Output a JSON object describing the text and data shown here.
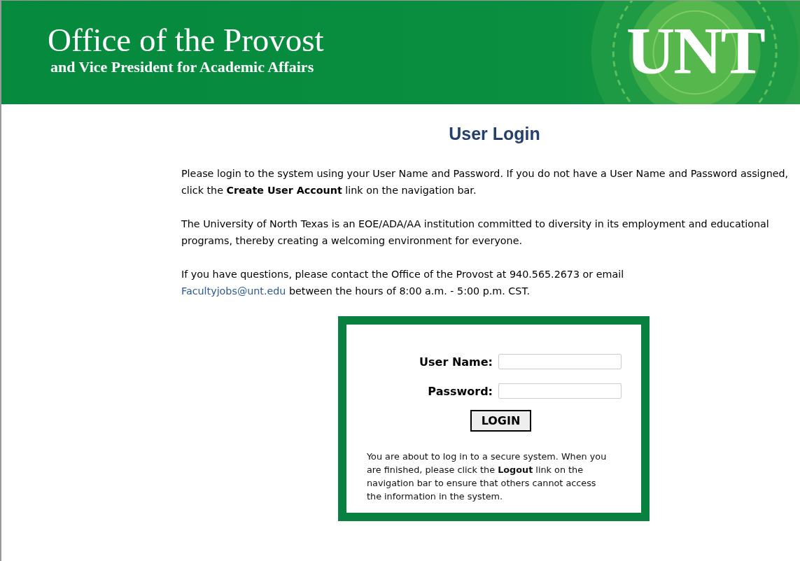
{
  "header": {
    "title": "Office of the Provost",
    "subtitle": "and Vice President for Academic Affairs",
    "logo": "UNT"
  },
  "heading": "User Login",
  "paragraphs": [
    {
      "text": "Please login to the system using your User Name and Password. If you do not have a User Name and Password assigned, click the **Create User Account** link on the navigation bar."
    },
    {
      "text": "The University of North Texas is an EOE/ADA/AA institution committed to diversity in its employment and educational programs, thereby creating a welcoming environment for everyone."
    }
  ],
  "contact": {
    "before": "If you have questions, please contact the Office of the Provost at 940.565.2673 or email",
    "link": "Facultyjobs@unt.edu",
    "after": "between the hours of 8:00 a.m. - 5:00 p.m. CST."
  },
  "login": {
    "fields": [
      {
        "label": "User Name:"
      },
      {
        "label": "Password:"
      }
    ],
    "button": "LOGIN",
    "notice": "You are about to log in to a secure system. When you are finished, please click the **Logout** link on the navigation bar to ensure that others cannot access the information in the system."
  }
}
